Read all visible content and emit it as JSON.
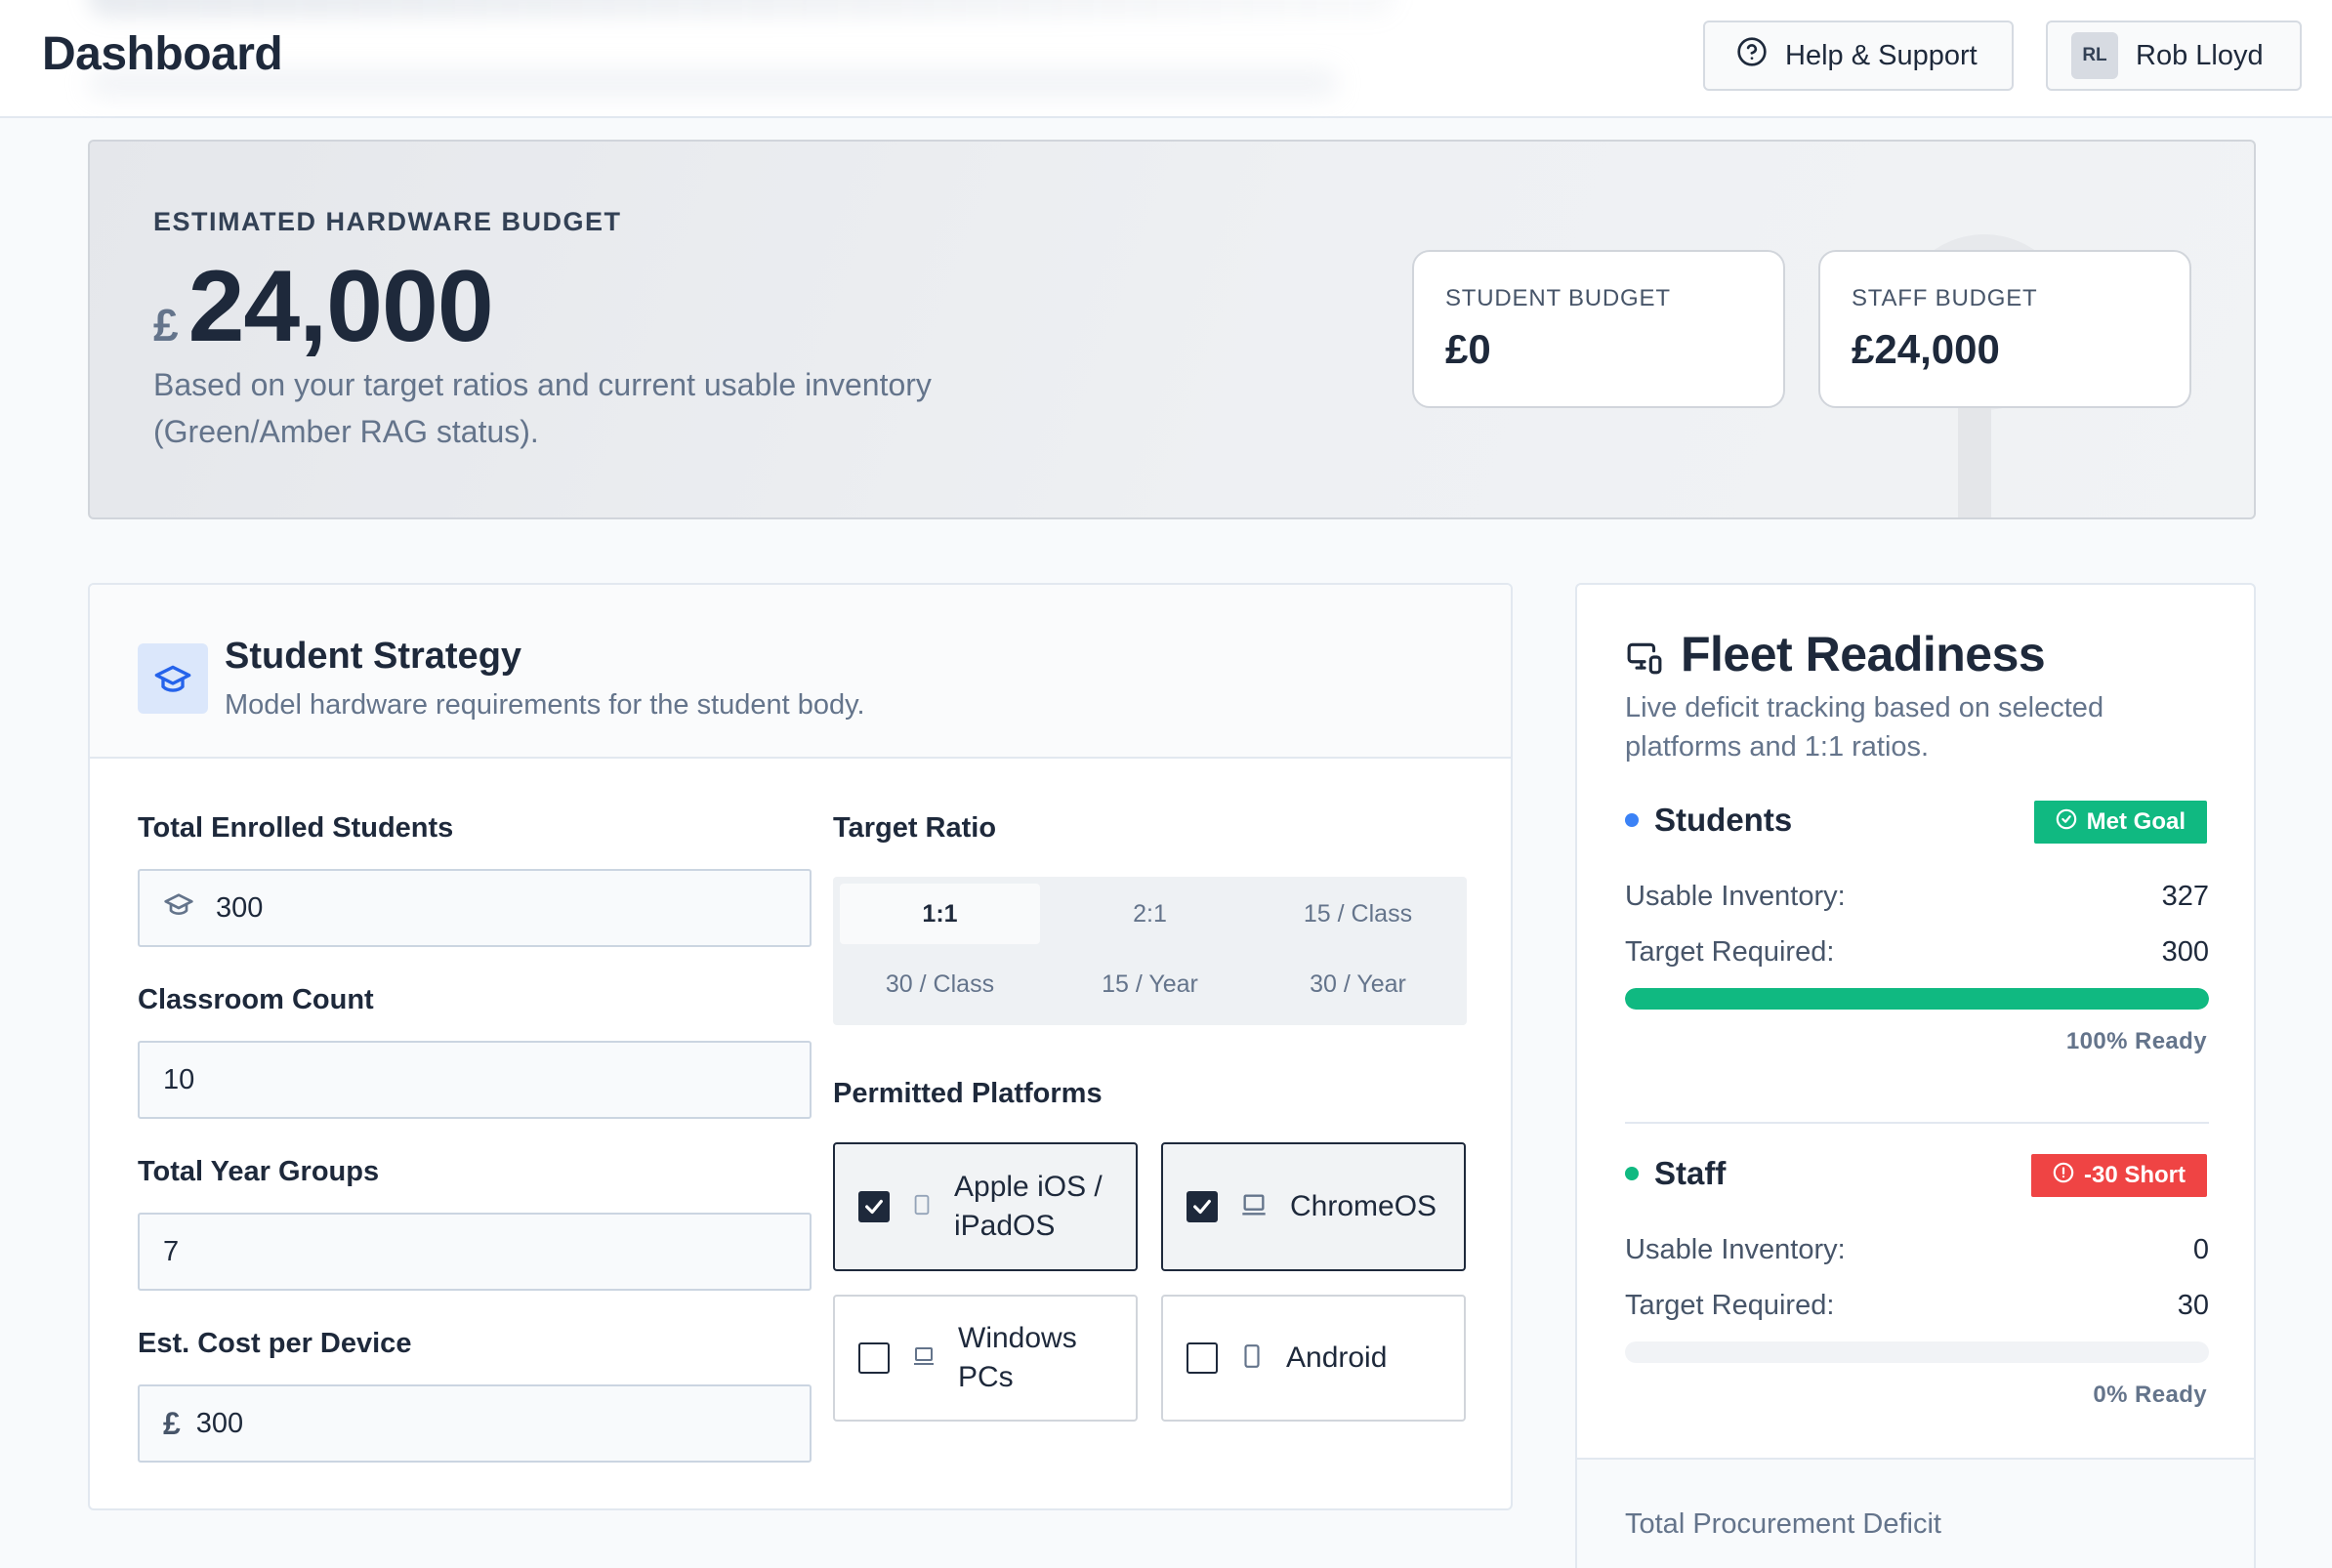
{
  "header": {
    "title": "Dashboard",
    "help_label": "Help & Support",
    "user": {
      "initials": "RL",
      "name": "Rob Lloyd"
    }
  },
  "budget": {
    "label": "ESTIMATED HARDWARE BUDGET",
    "currency": "£",
    "amount": "24,000",
    "description": "Based on your target ratios and current usable inventory (Green/Amber RAG status).",
    "student": {
      "label": "STUDENT BUDGET",
      "value": "£0"
    },
    "staff": {
      "label": "STAFF BUDGET",
      "value": "£24,000"
    }
  },
  "strategy": {
    "title": "Student Strategy",
    "subtitle": "Model hardware requirements for the student body.",
    "fields": {
      "students": {
        "label": "Total Enrolled Students",
        "value": "300"
      },
      "classrooms": {
        "label": "Classroom Count",
        "value": "10"
      },
      "year_groups": {
        "label": "Total Year Groups",
        "value": "7"
      },
      "cost": {
        "label": "Est. Cost per Device",
        "currency": "£",
        "value": "300"
      }
    },
    "ratio": {
      "label": "Target Ratio",
      "options": [
        "1:1",
        "2:1",
        "15 / Class",
        "30 / Class",
        "15 / Year",
        "30 / Year"
      ],
      "selected": "1:1"
    },
    "platforms": {
      "label": "Permitted Platforms",
      "items": [
        {
          "name": "Apple iOS / iPadOS",
          "checked": true,
          "icon": "tablet-icon"
        },
        {
          "name": "ChromeOS",
          "checked": true,
          "icon": "laptop-icon"
        },
        {
          "name": "Windows PCs",
          "checked": false,
          "icon": "laptop-icon"
        },
        {
          "name": "Android",
          "checked": false,
          "icon": "phone-icon"
        }
      ]
    }
  },
  "fleet": {
    "title": "Fleet Readiness",
    "subtitle": "Live deficit tracking based on selected platforms and 1:1 ratios.",
    "students": {
      "label": "Students",
      "badge": "Met Goal",
      "inventory_label": "Usable Inventory:",
      "inventory": "327",
      "required_label": "Target Required:",
      "required": "300",
      "ready_pct": 100,
      "ready_text": "100% Ready"
    },
    "staff": {
      "label": "Staff",
      "badge": "-30 Short",
      "inventory_label": "Usable Inventory:",
      "inventory": "0",
      "required_label": "Target Required:",
      "required": "30",
      "ready_pct": 0,
      "ready_text": "0% Ready"
    },
    "footer_label": "Total Procurement Deficit"
  },
  "colors": {
    "accent_blue": "#3b82f6",
    "success": "#10b981",
    "danger": "#ef4444",
    "dark": "#1e293b"
  }
}
